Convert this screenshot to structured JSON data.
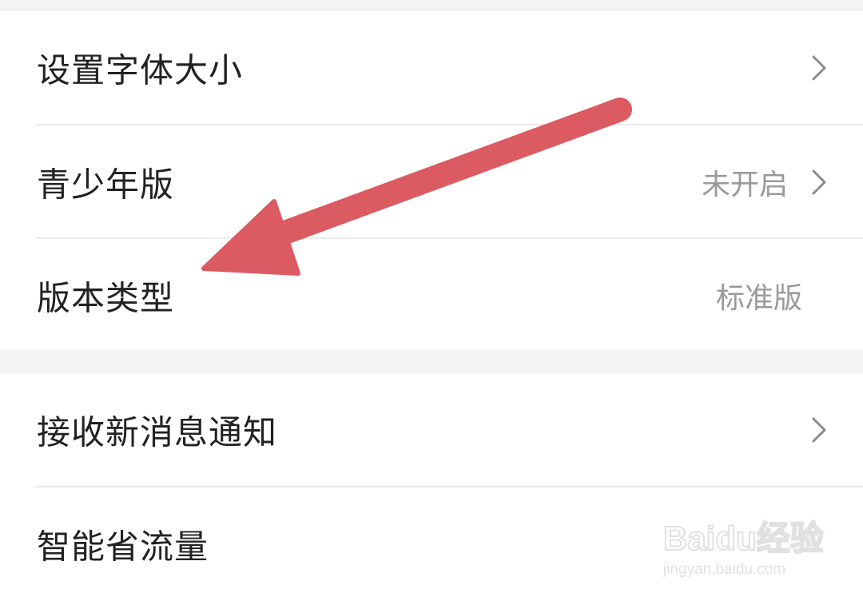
{
  "settings": {
    "group1": [
      {
        "label": "设置字体大小",
        "value": "",
        "has_chevron": true
      },
      {
        "label": "青少年版",
        "value": "未开启",
        "has_chevron": true
      },
      {
        "label": "版本类型",
        "value": "标准版",
        "has_chevron": false
      }
    ],
    "group2": [
      {
        "label": "接收新消息通知",
        "value": "",
        "has_chevron": true
      },
      {
        "label": "智能省流量",
        "value": "",
        "has_chevron": false
      }
    ]
  },
  "icons": {
    "chevron": "chevron-right-icon",
    "annotation": "arrow-annotation-icon"
  },
  "watermark": {
    "logo_text": "Baidu经验",
    "url": "jingyan.baidu.com"
  },
  "colors": {
    "background": "#f2f3f5",
    "row_background": "#ffffff",
    "label_text": "#222222",
    "value_text": "#9a9a9a",
    "chevron": "#8a8a8a",
    "divider": "#ececec",
    "annotation_arrow": "#dc5a61"
  }
}
